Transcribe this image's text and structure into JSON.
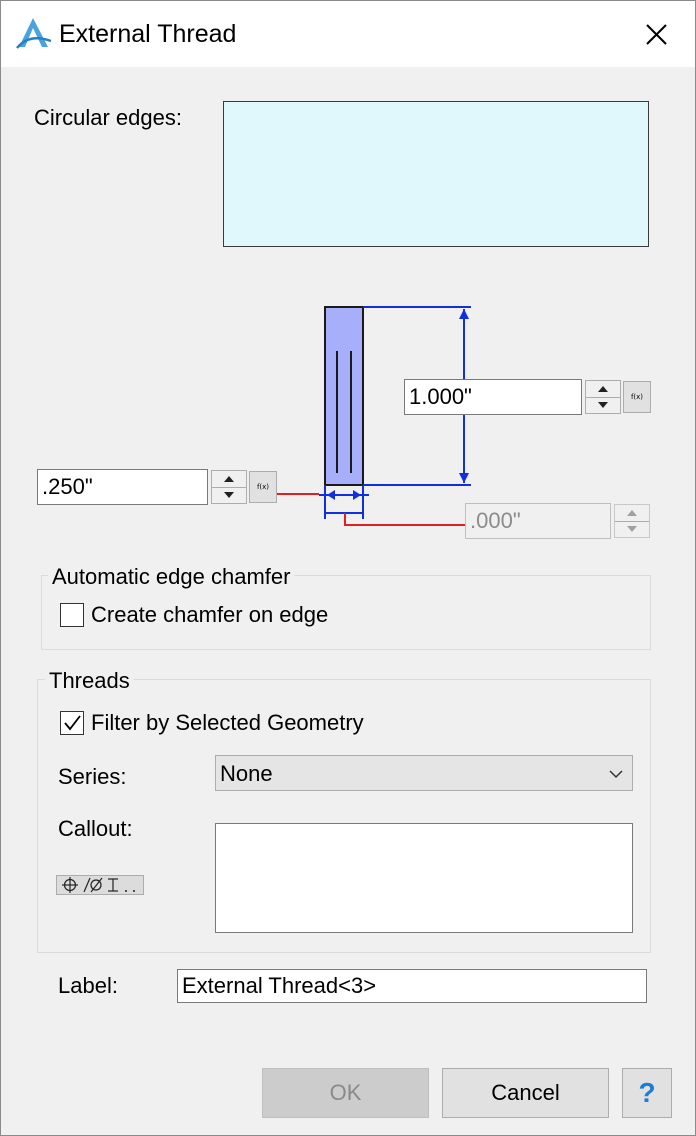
{
  "window": {
    "title": "External Thread",
    "app_icon": "alibre-logo-icon",
    "close_icon": "close-icon"
  },
  "circular_edges": {
    "label": "Circular edges:",
    "box_color": "#e0f8fc"
  },
  "diagram": {
    "height_value": "1.000\"",
    "diameter_value": ".250\"",
    "offset_value": ".000\"",
    "fx_label": "f(x)",
    "colors": {
      "body": "#a7aefa",
      "dimension": "#1030e0",
      "leader": "#e02020"
    }
  },
  "chamfer": {
    "group_title": "Automatic edge chamfer",
    "checkbox_label": "Create chamfer on edge",
    "checked": false
  },
  "threads": {
    "group_title": "Threads",
    "filter_label": "Filter by Selected Geometry",
    "filter_checked": true,
    "series_label": "Series:",
    "series_value": "None",
    "callout_label": "Callout:",
    "callout_value": "",
    "symbols_icon": "gdt-symbols-icon"
  },
  "label_field": {
    "label": "Label:",
    "value": "External Thread<3>"
  },
  "buttons": {
    "ok": "OK",
    "cancel": "Cancel",
    "help": "?"
  }
}
